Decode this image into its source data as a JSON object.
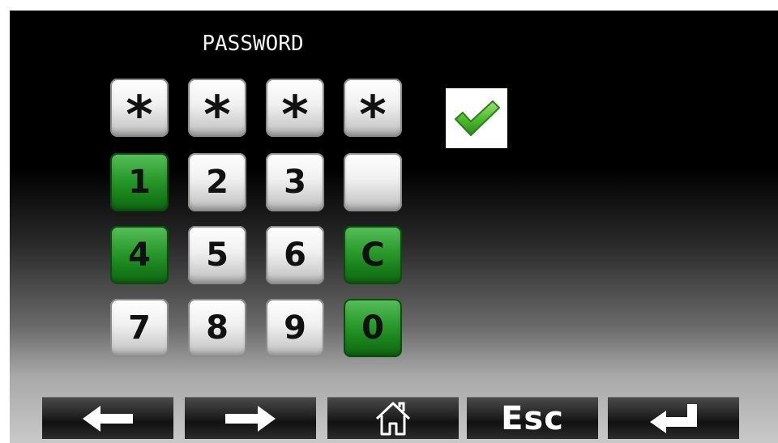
{
  "screen": {
    "title": "PASSWORD"
  },
  "password_display": [
    "*",
    "*",
    "*",
    "*"
  ],
  "keypad": {
    "rows": [
      [
        {
          "label": "1",
          "style": "green"
        },
        {
          "label": "2",
          "style": "gray"
        },
        {
          "label": "3",
          "style": "gray"
        },
        {
          "label": "",
          "style": "gray"
        }
      ],
      [
        {
          "label": "4",
          "style": "green"
        },
        {
          "label": "5",
          "style": "gray"
        },
        {
          "label": "6",
          "style": "gray"
        },
        {
          "label": "C",
          "style": "green"
        }
      ],
      [
        {
          "label": "7",
          "style": "gray"
        },
        {
          "label": "8",
          "style": "gray"
        },
        {
          "label": "9",
          "style": "gray"
        },
        {
          "label": "0",
          "style": "green"
        }
      ]
    ]
  },
  "confirm": {
    "icon": "checkmark-icon",
    "color": "#3fae2a"
  },
  "toolbar": {
    "back_icon": "arrow-left-icon",
    "forward_icon": "arrow-right-icon",
    "home_icon": "home-icon",
    "esc_label": "Esc",
    "enter_icon": "enter-return-icon"
  },
  "colors": {
    "key_green": "#2a9a2c",
    "key_gray": "#e6e6e6",
    "background_top": "#000000",
    "background_bottom": "#c9c9c9"
  }
}
